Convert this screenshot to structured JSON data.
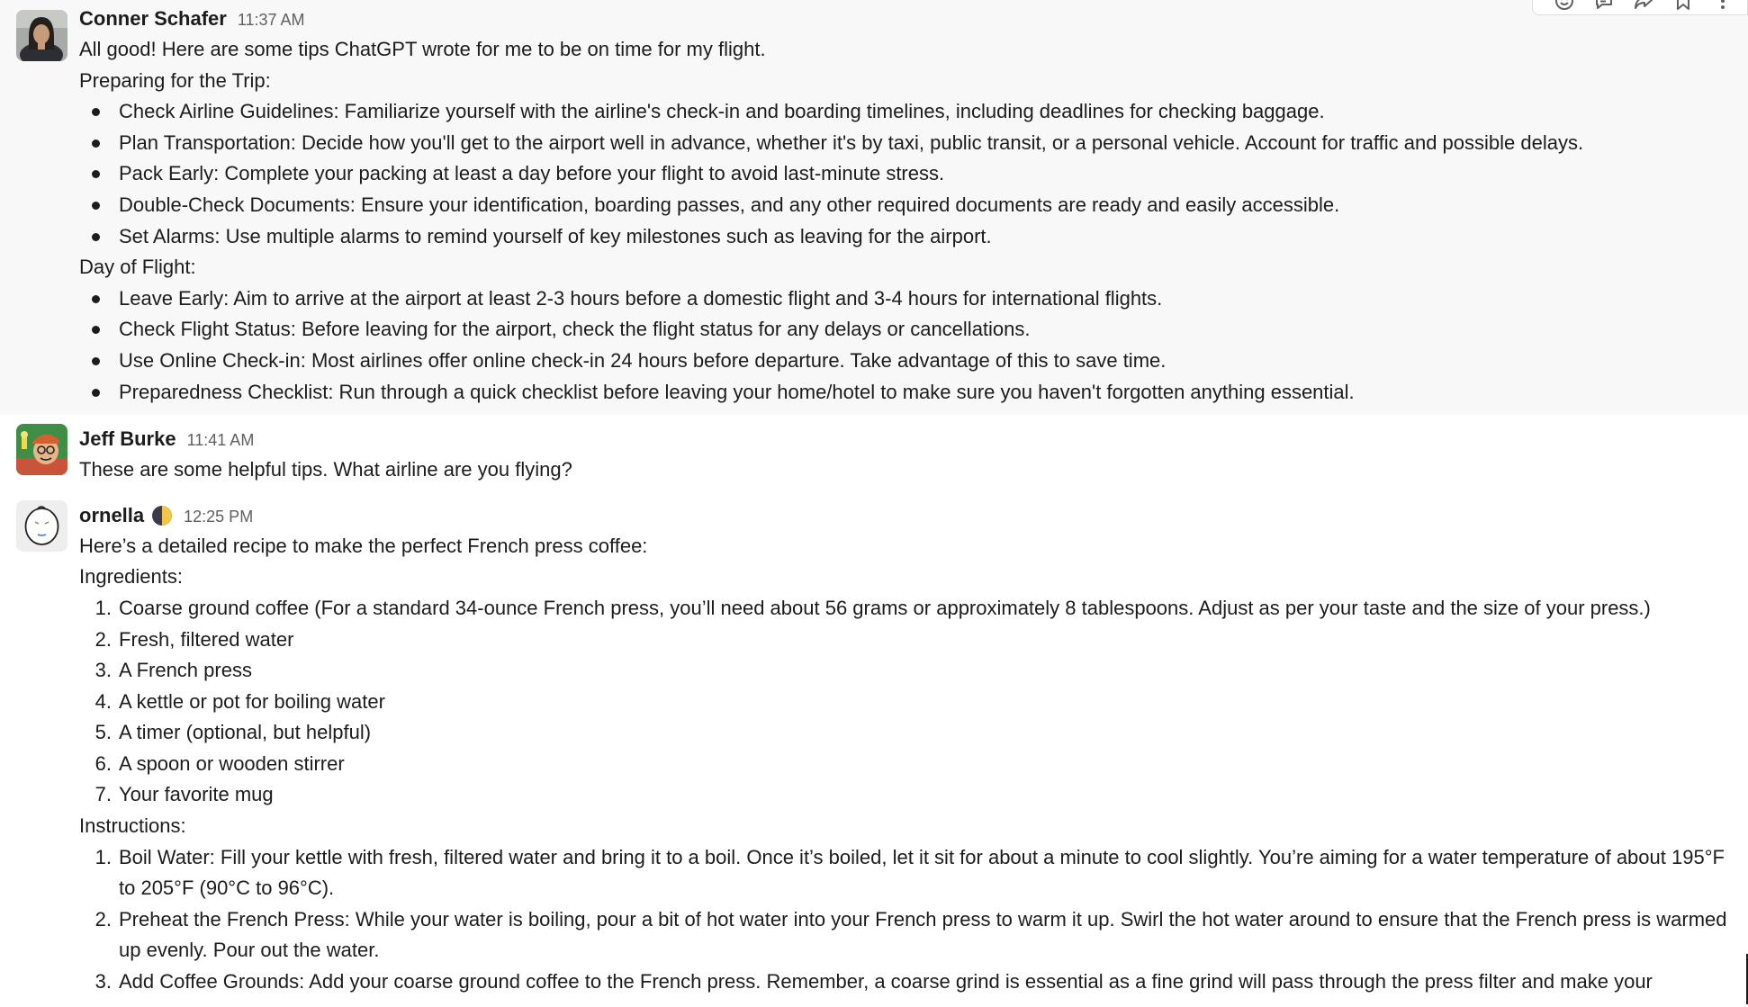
{
  "messages": {
    "m1": {
      "author": "Conner Schafer",
      "time": "11:37 AM",
      "intro": "All good! Here are some tips ChatGPT wrote for me to be on time for my flight.",
      "section1": "Preparing for the Trip:",
      "prep": [
        "Check Airline Guidelines: Familiarize yourself with the airline's check-in and boarding timelines, including deadlines for checking baggage.",
        "Plan Transportation: Decide how you'll get to the airport well in advance, whether it's by taxi, public transit, or a personal vehicle. Account for traffic and possible delays.",
        "Pack Early: Complete your packing at least a day before your flight to avoid last-minute stress.",
        "Double-Check Documents: Ensure your identification, boarding passes, and any other required documents are ready and easily accessible.",
        "Set Alarms: Use multiple alarms to remind yourself of key milestones such as leaving for the airport."
      ],
      "section2": "Day of Flight:",
      "day": [
        "Leave Early: Aim to arrive at the airport at least 2-3 hours before a domestic flight and 3-4 hours for international flights.",
        "Check Flight Status: Before leaving for the airport, check the flight status for any delays or cancellations.",
        "Use Online Check-in: Most airlines offer online check-in 24 hours before departure. Take advantage of this to save time.",
        "Preparedness Checklist: Run through a quick checklist before leaving your home/hotel to make sure you haven't forgotten anything essential."
      ]
    },
    "m2": {
      "author": "Jeff Burke",
      "time": "11:41 AM",
      "text": "These are some helpful tips. What airline are you flying?"
    },
    "m3": {
      "author": "ornella",
      "status_emoji": "first-quarter-moon",
      "time": "12:25 PM",
      "intro": "Here’s a detailed recipe to make the perfect French press coffee:",
      "ingredients_label": "Ingredients:",
      "ingredients": [
        {
          "n": "1.",
          "t": "Coarse ground coffee (For a standard 34-ounce French press, you’ll need about 56 grams or approximately 8 tablespoons. Adjust as per your taste and the size of your press.)"
        },
        {
          "n": "2.",
          "t": "Fresh, filtered water"
        },
        {
          "n": "3.",
          "t": "A French press"
        },
        {
          "n": "4.",
          "t": "A kettle or pot for boiling water"
        },
        {
          "n": "5.",
          "t": "A timer (optional, but helpful)"
        },
        {
          "n": "6.",
          "t": "A spoon or wooden stirrer"
        },
        {
          "n": "7.",
          "t": "Your favorite mug"
        }
      ],
      "instructions_label": "Instructions:",
      "instructions": [
        {
          "n": "1.",
          "t": "Boil Water: Fill your kettle with fresh, filtered water and bring it to a boil. Once it’s boiled, let it sit for about a minute to cool slightly. You’re aiming for a water temperature of about 195°F to 205°F (90°C to 96°C)."
        },
        {
          "n": "2.",
          "t": "Preheat the French Press: While your water is boiling, pour a bit of hot water into your French press to warm it up. Swirl the hot water around to ensure that the French press is warmed up evenly. Pour out the water."
        },
        {
          "n": "3.",
          "t": "Add Coffee Grounds: Add your coarse ground coffee to the French press. Remember, a coarse grind is essential as a fine grind will pass through the press filter and make your"
        }
      ]
    }
  },
  "message_actions": [
    "add-reaction-icon",
    "reply-in-thread-icon",
    "forward-icon",
    "bookmark-icon",
    "more-actions-icon"
  ],
  "colors": {
    "hover_bg": "#f8f8f8",
    "text": "#1d1c1d",
    "timestamp": "#616061"
  }
}
